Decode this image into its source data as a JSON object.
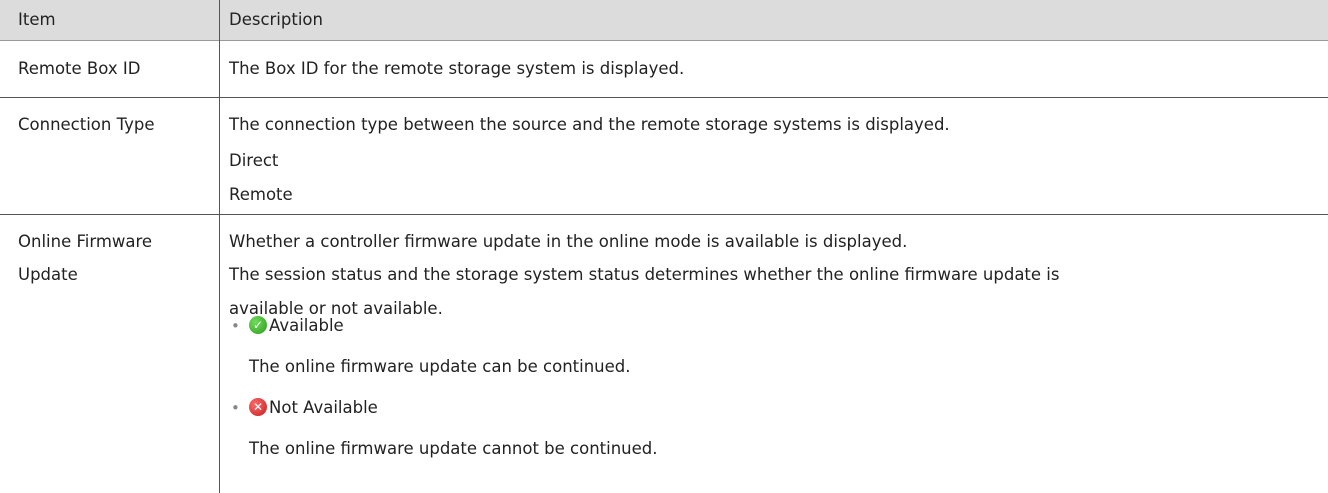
{
  "header": {
    "item": "Item",
    "description": "Description"
  },
  "rows": [
    {
      "item": "Remote Box ID",
      "description": [
        "The Box ID for the remote storage system is displayed."
      ]
    },
    {
      "item": "Connection Type",
      "description": [
        "The connection type between the source and the remote storage systems is displayed.",
        "Direct",
        "Remote"
      ]
    },
    {
      "item_lines": [
        "Online Firmware",
        "Update"
      ],
      "description": [
        "Whether a controller firmware update in the online mode is available is displayed.",
        "The session status and the storage system status determines whether the online firmware update is",
        "available or not available."
      ],
      "statuses": [
        {
          "icon": "check-circle-icon",
          "color": "#2f9a1e",
          "label": "Available",
          "detail": "The online firmware update can be continued."
        },
        {
          "icon": "x-circle-icon",
          "color": "#c31e1e",
          "label": "Not Available",
          "detail": "The online firmware update cannot be continued."
        }
      ]
    }
  ]
}
